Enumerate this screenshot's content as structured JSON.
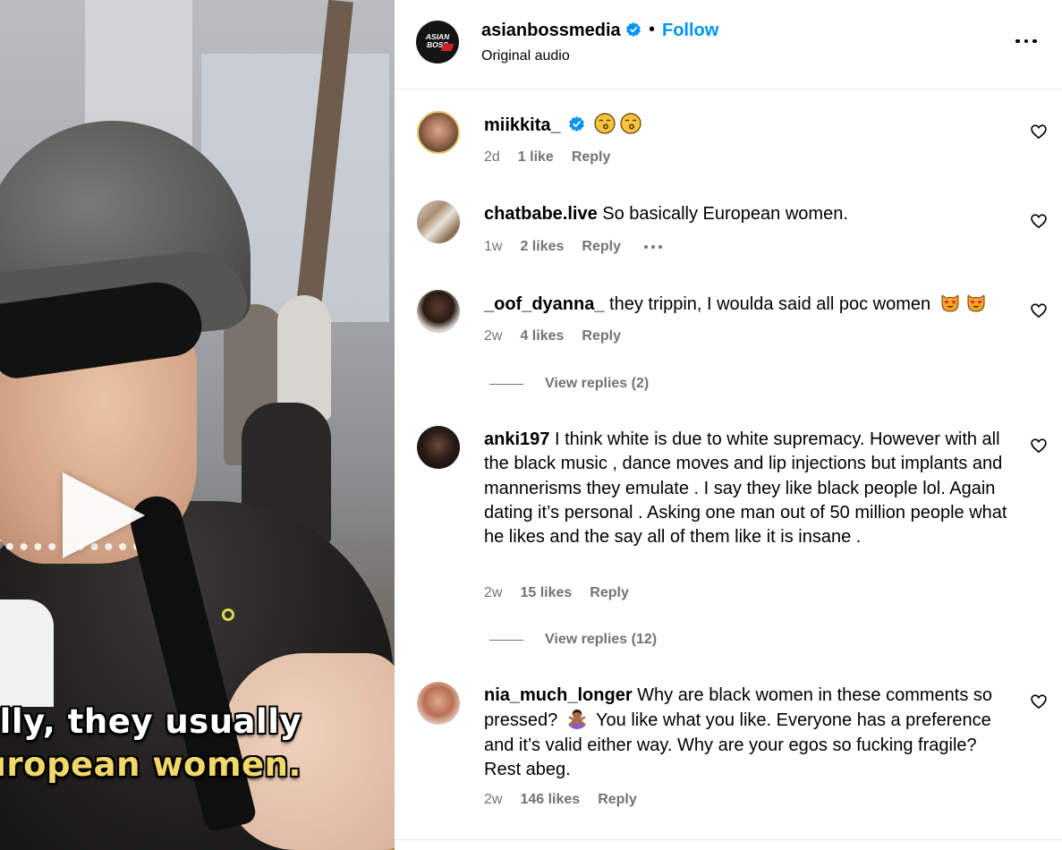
{
  "video": {
    "subtitle_line1": "ully, they usually",
    "subtitle_line2": "uropean women."
  },
  "header": {
    "logo_line1": "ASIAN",
    "logo_line2": "BOSS",
    "username": "asianbossmedia",
    "separator": "•",
    "follow_label": "Follow",
    "audio_label": "Original audio"
  },
  "comments": [
    {
      "username": "miikkita_",
      "text": "",
      "time": "2d",
      "likes": "1 like",
      "reply": "Reply",
      "verified": true
    },
    {
      "username": "chatbabe.live",
      "text": "So basically European women.",
      "time": "1w",
      "likes": "2 likes",
      "reply": "Reply"
    },
    {
      "username": "_oof_dyanna_",
      "text": "they trippin, I woulda said all poc women",
      "time": "2w",
      "likes": "4 likes",
      "reply": "Reply",
      "view_replies": "View replies (2)"
    },
    {
      "username": "anki197",
      "text": "I think white is due to white supremacy. However with all the black music , dance moves and lip injections but implants and mannerisms they emulate . I say they like black people lol. Again dating it’s personal . Asking one man out of 50 million people what he likes and the say all of them like it is insane .",
      "time": "2w",
      "likes": "15 likes",
      "reply": "Reply",
      "view_replies": "View replies (12)"
    },
    {
      "username": "nia_much_longer",
      "text_before_emoji": "Why are black women in these comments so pressed?",
      "text_after_emoji": "You like what you like. Everyone has a preference and it’s valid either way. Why are your egos so fucking fragile? Rest abeg.",
      "time": "2w",
      "likes": "146 likes",
      "reply": "Reply"
    }
  ],
  "colors": {
    "link_blue": "#0095f6",
    "meta_gray": "#737373",
    "divider": "#e6e6e6",
    "subtitle_yellow": "#f2d76a",
    "logo_red": "#d51b23"
  },
  "icons": {
    "more": "more-horizontal-icon",
    "heart": "heart-outline-icon",
    "verified": "verified-badge-icon",
    "play": "play-icon"
  }
}
